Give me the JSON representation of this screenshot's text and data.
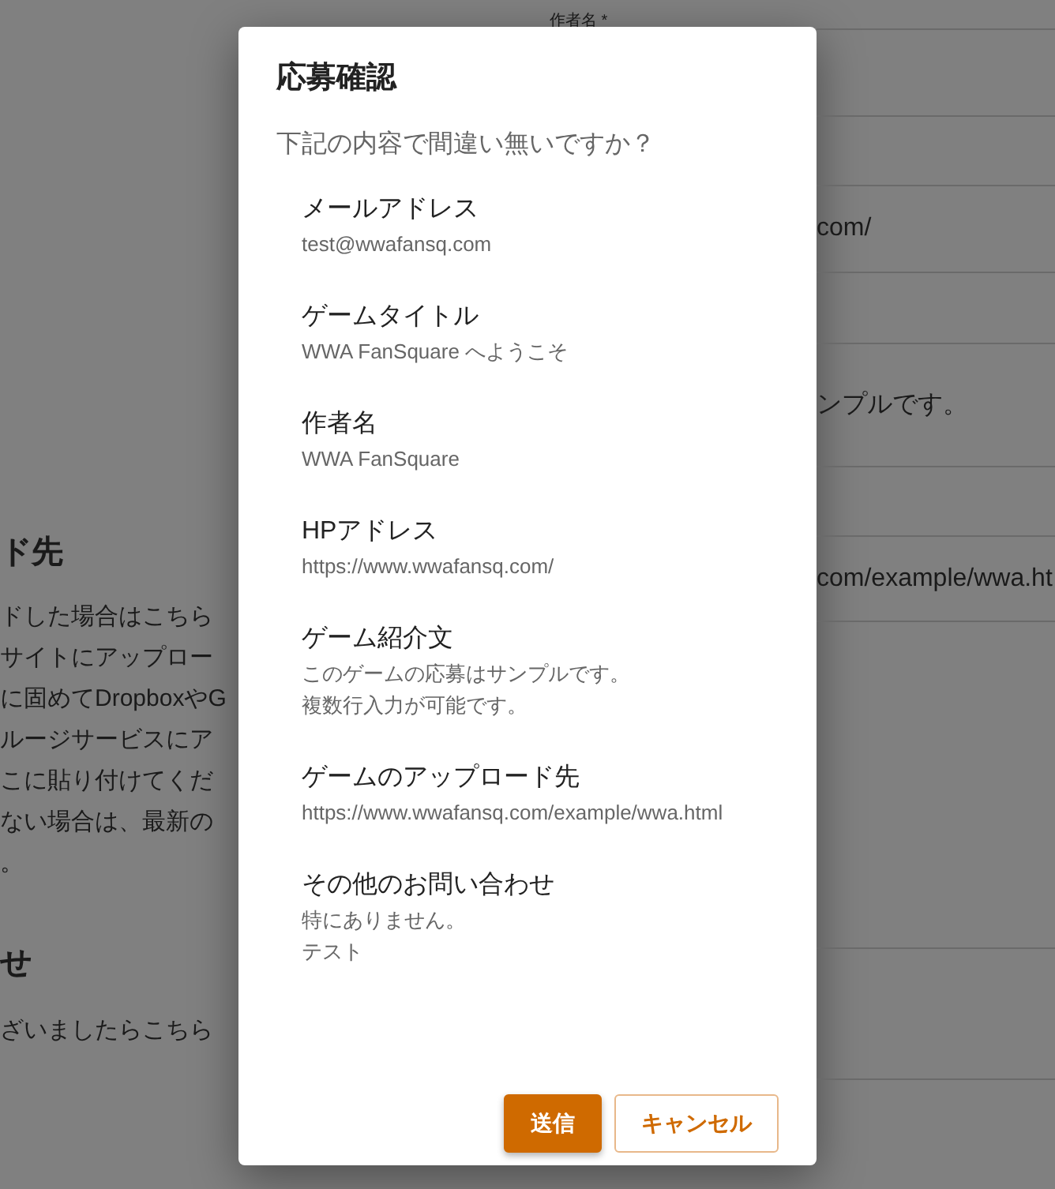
{
  "background": {
    "field_label": "作者名 *",
    "left_texts": [
      {
        "kind": "heading",
        "text": "ド先"
      },
      {
        "kind": "body",
        "text": "ドした場合はこちら"
      },
      {
        "kind": "body",
        "text": "サイトにアップロー"
      },
      {
        "kind": "body",
        "text": "に固めてDropboxやG"
      },
      {
        "kind": "body",
        "text": "ルージサービスにア"
      },
      {
        "kind": "body",
        "text": "こに貼り付けてくだ"
      },
      {
        "kind": "body",
        "text": "ない場合は、最新の"
      },
      {
        "kind": "body",
        "text": "。"
      },
      {
        "kind": "heading",
        "text": "せ"
      },
      {
        "kind": "body",
        "text": "ざいましたらこちら"
      }
    ],
    "field_values": [
      "com/",
      "ンプルです。",
      "com/example/wwa.ht"
    ]
  },
  "dialog": {
    "title": "応募確認",
    "prompt": "下記の内容で間違い無いですか？",
    "items": [
      {
        "label": "メールアドレス",
        "lines": [
          "test@wwafansq.com"
        ]
      },
      {
        "label": "ゲームタイトル",
        "lines": [
          "WWA FanSquare へようこそ"
        ]
      },
      {
        "label": "作者名",
        "lines": [
          "WWA FanSquare"
        ]
      },
      {
        "label": "HPアドレス",
        "lines": [
          "https://www.wwafansq.com/"
        ]
      },
      {
        "label": "ゲーム紹介文",
        "lines": [
          "このゲームの応募はサンプルです。",
          "複数行入力が可能です。"
        ]
      },
      {
        "label": "ゲームのアップロード先",
        "lines": [
          "https://www.wwafansq.com/example/wwa.html"
        ]
      },
      {
        "label": "その他のお問い合わせ",
        "lines": [
          "特にありません。",
          "テスト"
        ]
      }
    ],
    "buttons": [
      {
        "kind": "primary",
        "label": "送信"
      },
      {
        "kind": "outline",
        "label": "キャンセル"
      }
    ]
  }
}
